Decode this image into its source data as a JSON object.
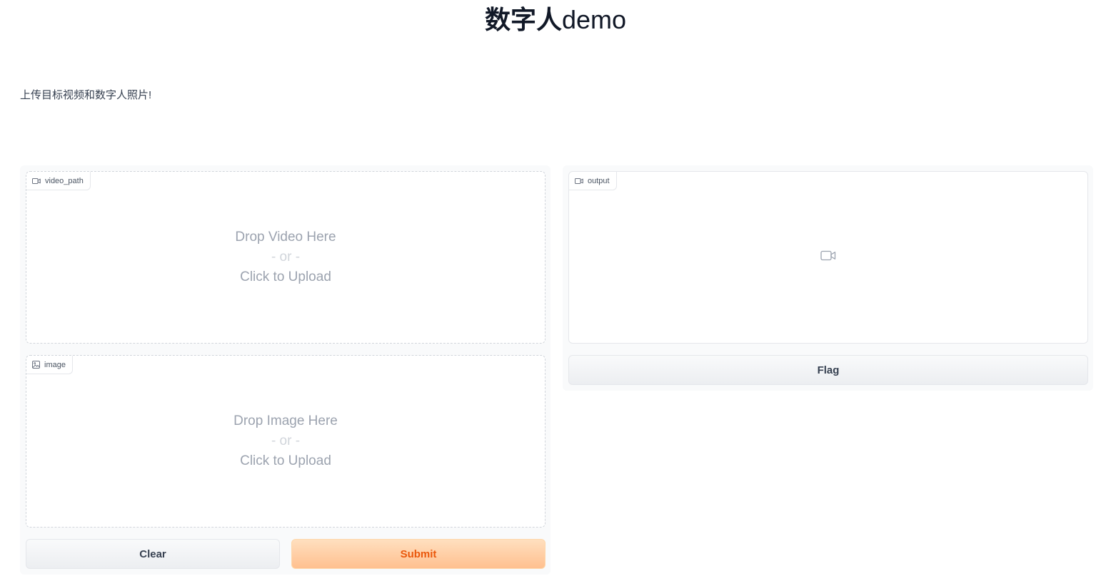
{
  "page": {
    "title_cjk": "数字人",
    "title_ascii": "demo",
    "description": "上传目标视频和数字人照片!"
  },
  "inputs": {
    "video": {
      "label": "video_path",
      "icon": "video-icon",
      "drop_text": "Drop Video Here",
      "or_text": "- or -",
      "click_text": "Click to Upload"
    },
    "image": {
      "label": "image",
      "icon": "image-icon",
      "drop_text": "Drop Image Here",
      "or_text": "- or -",
      "click_text": "Click to Upload"
    }
  },
  "output": {
    "label": "output",
    "icon": "video-icon",
    "placeholder_icon": "video-icon"
  },
  "buttons": {
    "clear": "Clear",
    "submit": "Submit",
    "flag": "Flag"
  },
  "colors": {
    "primary_text": "#ea580c",
    "primary_bg_top": "#ffdfbf",
    "primary_bg_bottom": "#ffc08f",
    "panel_bg": "#f9fafb"
  }
}
